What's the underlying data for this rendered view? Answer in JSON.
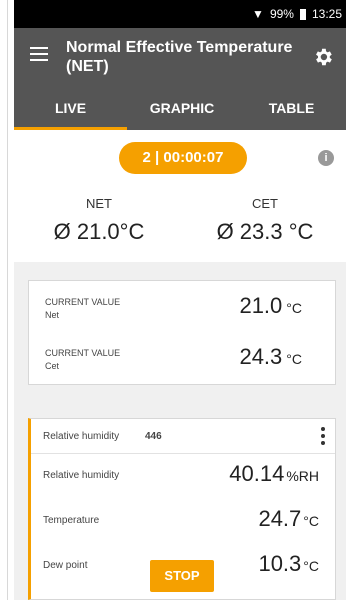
{
  "status": {
    "battery": "99%",
    "time": "13:25"
  },
  "appbar": {
    "title_line1": "Normal Effective Temperature",
    "title_line2": "(NET)"
  },
  "tabs": [
    "LIVE",
    "GRAPHIC",
    "TABLE"
  ],
  "timer": "2 | 00:00:07",
  "summary": {
    "net_label": "NET",
    "net_value": "Ø 21.0°C",
    "cet_label": "CET",
    "cet_value": "Ø 23.3 °C"
  },
  "current_values": [
    {
      "label": "CURRENT VALUE",
      "sub": "Net",
      "value": "21.0",
      "unit": "°C"
    },
    {
      "label": "CURRENT VALUE",
      "sub": "Cet",
      "value": "24.3",
      "unit": "°C"
    }
  ],
  "sensor": {
    "name": "Relative humidity",
    "id": "446",
    "rows": [
      {
        "label": "Relative humidity",
        "value": "40.14",
        "unit": "%RH"
      },
      {
        "label": "Temperature",
        "value": "24.7",
        "unit": "°C"
      },
      {
        "label": "Dew point",
        "value": "10.3",
        "unit": "°C"
      }
    ]
  },
  "stop_label": "STOP",
  "colors": {
    "accent": "#f5a000",
    "appbar": "#555555"
  }
}
